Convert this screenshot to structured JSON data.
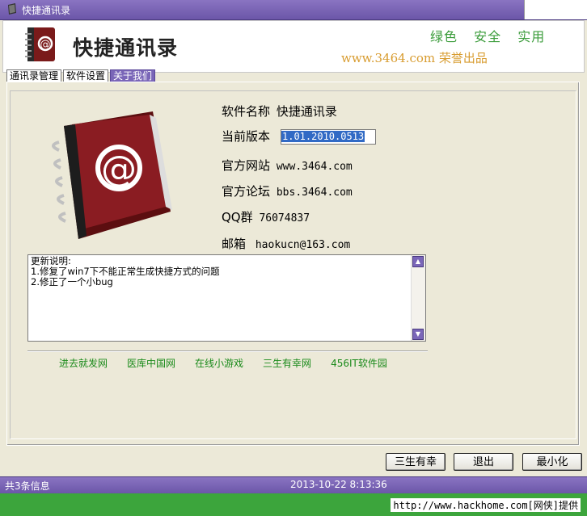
{
  "window": {
    "title": "快捷通讯录"
  },
  "header": {
    "app_name": "快捷通讯录",
    "slogan": [
      "绿色",
      "安全",
      "实用"
    ],
    "vendor": "www.3464.com 荣誉出品"
  },
  "tabs": [
    {
      "label": "通讯录管理",
      "active": false
    },
    {
      "label": "软件设置",
      "active": false
    },
    {
      "label": "关于我们",
      "active": true
    }
  ],
  "about": {
    "software_name_label": "软件名称",
    "software_name": "快捷通讯录",
    "version_label": "当前版本",
    "version": "1.01.2010.0513",
    "site_label": "官方网站",
    "site": "www.3464.com",
    "forum_label": "官方论坛",
    "forum": "bbs.3464.com",
    "qq_label": "QQ群",
    "qq": "76074837",
    "email_label": "邮箱",
    "email": "haokucn@163.com"
  },
  "notes": "更新说明:\n1.修复了win7下不能正常生成快捷方式的问题\n2.修正了一个小bug",
  "links": [
    "进去就发网",
    "医库中国网",
    "在线小游戏",
    "三生有幸网",
    "456IT软件园"
  ],
  "buttons": {
    "sansheng": "三生有幸",
    "exit": "退出",
    "minimize": "最小化"
  },
  "status": {
    "count": "共3条信息",
    "datetime": "2013-10-22 8:13:36"
  },
  "footer": {
    "credit": "http://www.hackhome.com[网侠]提供"
  },
  "colors": {
    "accent": "#7a66b8",
    "green": "#3ca53c",
    "link": "#1a8a1a",
    "slogan": "#3b9c3b",
    "vendor": "#d89c30"
  }
}
